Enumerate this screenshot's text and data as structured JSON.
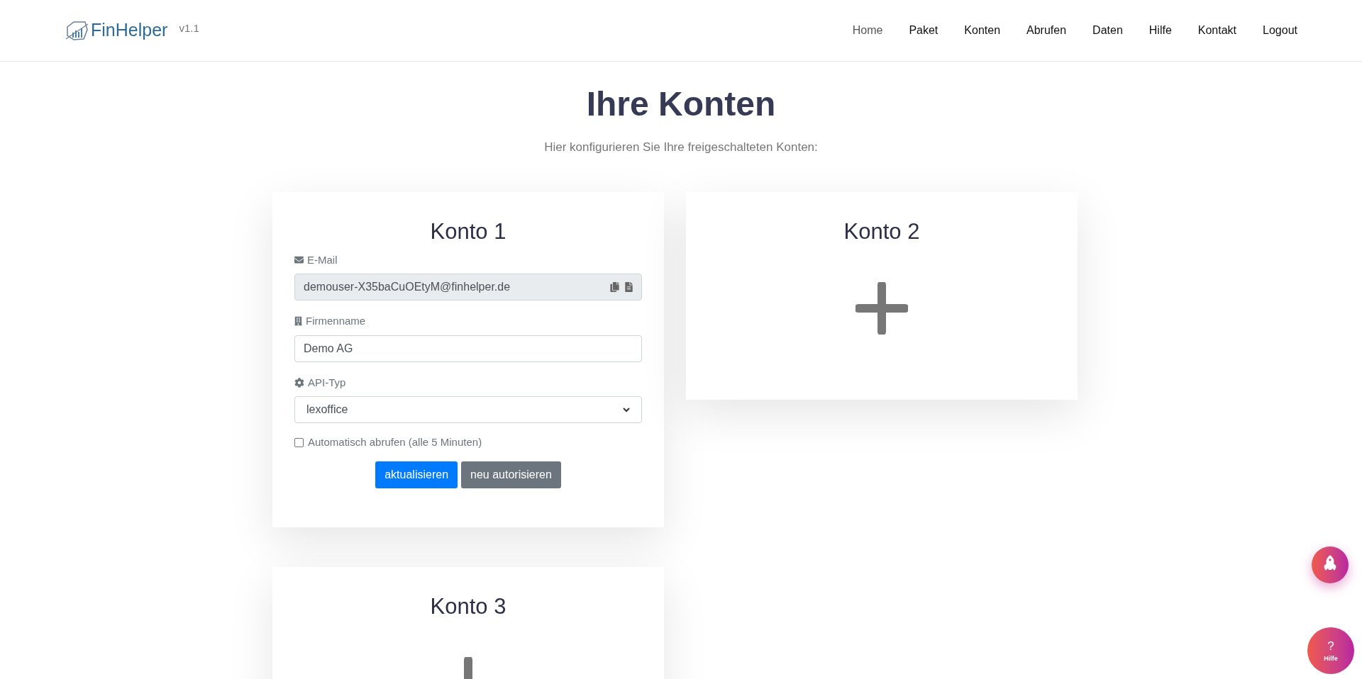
{
  "header": {
    "brand": "FinHelper",
    "version": "v1.1",
    "nav": [
      {
        "label": "Home",
        "selected": true
      },
      {
        "label": "Paket",
        "selected": false
      },
      {
        "label": "Konten",
        "selected": false
      },
      {
        "label": "Abrufen",
        "selected": false
      },
      {
        "label": "Daten",
        "selected": false
      },
      {
        "label": "Hilfe",
        "selected": false
      },
      {
        "label": "Kontakt",
        "selected": false
      },
      {
        "label": "Logout",
        "selected": false
      }
    ]
  },
  "page": {
    "title": "Ihre Konten",
    "subtitle": "Hier konfigurieren Sie Ihre freigeschalteten Konten:"
  },
  "accounts": [
    {
      "kind": "form",
      "title": "Konto 1",
      "email_label": "E-Mail",
      "email": "demouser-X35baCuOEtyM@finhelper.de",
      "company_label": "Firmenname",
      "company": "Demo AG",
      "api_label": "API-Typ",
      "api": "lexoffice",
      "auto_fetch": {
        "label": "Automatisch abrufen (alle 5 Minuten)",
        "checked": false
      },
      "buttons": [
        "aktualisieren",
        "neu autorisieren"
      ]
    },
    {
      "kind": "empty",
      "title": "Konto 2"
    },
    {
      "kind": "empty",
      "title": "Konto 3"
    }
  ],
  "floating": {
    "help_label": "?",
    "help_caption": "Hilfe"
  }
}
